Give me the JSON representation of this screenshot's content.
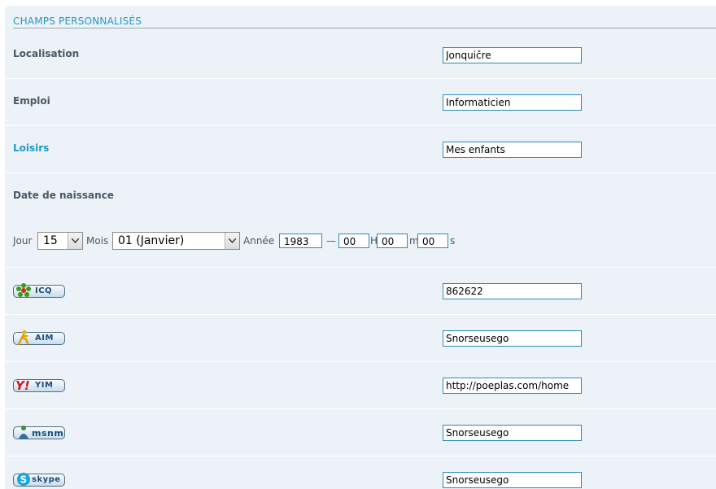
{
  "section": {
    "title": "CHAMPS PERSONNALISÉS"
  },
  "fields": {
    "location": {
      "label": "Localisation",
      "value": "Jonquičre"
    },
    "job": {
      "label": "Emploi",
      "value": "Informaticien"
    },
    "hobbies": {
      "label": "Loisirs",
      "value": "Mes enfants"
    }
  },
  "birthdate": {
    "label": "Date de naissance",
    "day_label": "Jour",
    "day_value": "15",
    "month_label": "Mois",
    "month_value": "01 (Janvier)",
    "year_label": "Année",
    "year_value": "1983",
    "dash": "—",
    "hour_value": "00",
    "hour_suffix": "H",
    "minute_value": "00",
    "minute_suffix": "m",
    "second_value": "00",
    "second_suffix": "s"
  },
  "messengers": [
    {
      "name": "ICQ",
      "value": "862622",
      "icon": "icq-flower-icon"
    },
    {
      "name": "AIM",
      "value": "Snorseusego",
      "icon": "aim-runner-icon"
    },
    {
      "name": "YIM",
      "value": "http://poeplas.com/home",
      "icon": "yahoo-icon"
    },
    {
      "name": "msnm",
      "value": "Snorseusego",
      "icon": "msn-butterfly-icon"
    },
    {
      "name": "skype",
      "value": "Snorseusego",
      "icon": "skype-icon"
    }
  ],
  "colors": {
    "accent": "#1f9ac8",
    "panel_bg": "#ecf2f7",
    "field_border": "#2c8cb7"
  }
}
